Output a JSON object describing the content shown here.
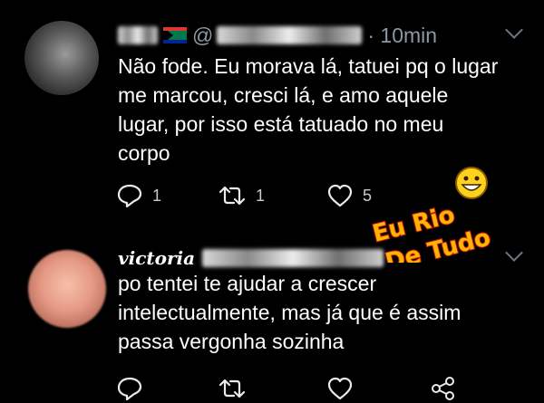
{
  "tweets": [
    {
      "handle_prefix": "@",
      "time": "· 10min",
      "text": "Não fode. Eu morava lá, tatuei pq o lugar\nme marcou, cresci lá, e amo aquele\nlugar, por isso está tatuado no meu\ncorpo",
      "reply_count": "1",
      "retweet_count": "1",
      "like_count": "5"
    },
    {
      "name": "victoria",
      "text": "po tentei te ajudar a crescer\nintelectualmente, mas já que é assim\npassa vergonha sozinha"
    }
  ],
  "watermark": {
    "line1": "Eu Rio",
    "line2": "De Tudo",
    "color_main": "#ffb400",
    "color_outline": "#c0161d"
  },
  "icons": {
    "reply": "reply-icon",
    "retweet": "retweet-icon",
    "like": "heart-icon",
    "share": "share-icon",
    "more": "chevron-down-icon",
    "flag": "south-africa-flag-icon"
  }
}
